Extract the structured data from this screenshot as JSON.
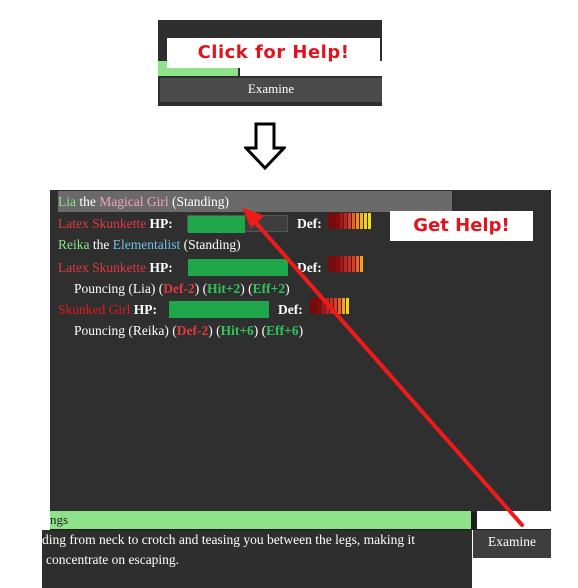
{
  "top_panel": {
    "help_banner": "Click for Help!",
    "examine_label": "Examine"
  },
  "annotation": {
    "get_help_banner": "Get Help!"
  },
  "combat": {
    "lia": {
      "name": "Lia",
      "the": "the",
      "title": "Magical Girl",
      "state": "(Standing)"
    },
    "skunkette1": {
      "name": "Latex Skunkette",
      "hp_label": "HP:",
      "hp_fraction": 0.57,
      "def_label": "Def:"
    },
    "reika": {
      "name": "Reika",
      "the": "the",
      "title": "Elementalist",
      "state": "(Standing)"
    },
    "skunkette2": {
      "name": "Latex Skunkette",
      "hp_label": "HP:",
      "hp_fraction": 1.0,
      "def_label": "Def:",
      "action": "Pouncing (Lia)",
      "mod1": "Def-2",
      "mod2": "Hit+2",
      "mod3": "Eff+2"
    },
    "skunked_girl": {
      "name": "Skunked Girl",
      "hp_label": "HP:",
      "hp_fraction": 1.0,
      "def_label": "Def:",
      "action": "Pouncing (Reika)",
      "mod1": "Def-2",
      "mod2": "Hit+6",
      "mod3": "Eff+6"
    }
  },
  "bottom": {
    "input_value": "ngs",
    "message_line1": "ding from neck to crotch and teasing you between the legs, making it",
    "message_line2": "concentrate on escaping.",
    "examine_label": "Examine"
  },
  "colors": {
    "accent_red": "#e0141e",
    "hp_green": "#1fa64a",
    "panel_dark": "#2f2f2f",
    "input_green": "#8ee28a"
  },
  "icons": [
    "down-arrow-icon",
    "pointer-arrow-icon"
  ]
}
